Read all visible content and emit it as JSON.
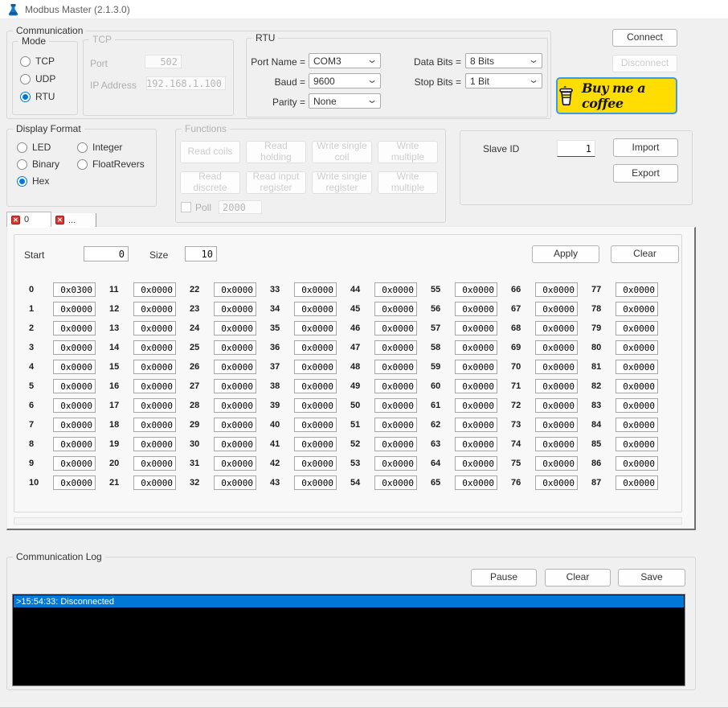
{
  "window": {
    "title": "Modbus Master (2.1.3.0)"
  },
  "colors": {
    "accent": "#0078d7",
    "coffee_bg": "#ffdd00",
    "tab_close": "#d83a33"
  },
  "communication": {
    "legend": "Communication",
    "mode": {
      "legend": "Mode",
      "options": [
        {
          "label": "TCP",
          "selected": false
        },
        {
          "label": "UDP",
          "selected": false
        },
        {
          "label": "RTU",
          "selected": true
        }
      ]
    },
    "tcp": {
      "legend": "TCP",
      "port_label": "Port",
      "port_value": "502",
      "ip_label": "IP Address",
      "ip_value": "192.168.1.100"
    },
    "rtu": {
      "legend": "RTU",
      "port_name_label": "Port Name =",
      "port_name_value": "COM3",
      "baud_label": "Baud =",
      "baud_value": "9600",
      "parity_label": "Parity =",
      "parity_value": "None",
      "data_bits_label": "Data Bits =",
      "data_bits_value": "8 Bits",
      "stop_bits_label": "Stop Bits =",
      "stop_bits_value": "1 Bit"
    }
  },
  "actions": {
    "connect": "Connect",
    "disconnect": "Disconnect",
    "coffee": "Buy me a coffee"
  },
  "display_format": {
    "legend": "Display Format",
    "options": [
      {
        "label": "LED",
        "selected": false
      },
      {
        "label": "Integer",
        "selected": false
      },
      {
        "label": "Binary",
        "selected": false
      },
      {
        "label": "FloatRevers",
        "selected": false
      },
      {
        "label": "Hex",
        "selected": true
      }
    ]
  },
  "functions": {
    "legend": "Functions",
    "buttons": [
      "Read coils",
      "Read holding",
      "Write single coil",
      "Write multiple",
      "Read discrete",
      "Read input register",
      "Write single register",
      "Write multiple"
    ],
    "poll_label": "Poll",
    "poll_value": "2000",
    "poll_checked": false
  },
  "slave": {
    "label": "Slave ID",
    "value": "1",
    "import_label": "Import",
    "export_label": "Export"
  },
  "tabs": [
    {
      "label": "0",
      "selected": true
    },
    {
      "label": "...",
      "selected": false
    }
  ],
  "register_panel": {
    "start_label": "Start",
    "start_value": "0",
    "size_label": "Size",
    "size_value": "10",
    "apply_label": "Apply",
    "clear_label": "Clear",
    "registers": [
      {
        "i": "0",
        "v": "0x0300"
      },
      {
        "i": "1",
        "v": "0x0000"
      },
      {
        "i": "2",
        "v": "0x0000"
      },
      {
        "i": "3",
        "v": "0x0000"
      },
      {
        "i": "4",
        "v": "0x0000"
      },
      {
        "i": "5",
        "v": "0x0000"
      },
      {
        "i": "6",
        "v": "0x0000"
      },
      {
        "i": "7",
        "v": "0x0000"
      },
      {
        "i": "8",
        "v": "0x0000"
      },
      {
        "i": "9",
        "v": "0x0000"
      },
      {
        "i": "10",
        "v": "0x0000"
      },
      {
        "i": "11",
        "v": "0x0000"
      },
      {
        "i": "12",
        "v": "0x0000"
      },
      {
        "i": "13",
        "v": "0x0000"
      },
      {
        "i": "14",
        "v": "0x0000"
      },
      {
        "i": "15",
        "v": "0x0000"
      },
      {
        "i": "16",
        "v": "0x0000"
      },
      {
        "i": "17",
        "v": "0x0000"
      },
      {
        "i": "18",
        "v": "0x0000"
      },
      {
        "i": "19",
        "v": "0x0000"
      },
      {
        "i": "20",
        "v": "0x0000"
      },
      {
        "i": "21",
        "v": "0x0000"
      },
      {
        "i": "22",
        "v": "0x0000"
      },
      {
        "i": "23",
        "v": "0x0000"
      },
      {
        "i": "24",
        "v": "0x0000"
      },
      {
        "i": "25",
        "v": "0x0000"
      },
      {
        "i": "26",
        "v": "0x0000"
      },
      {
        "i": "27",
        "v": "0x0000"
      },
      {
        "i": "28",
        "v": "0x0000"
      },
      {
        "i": "29",
        "v": "0x0000"
      },
      {
        "i": "30",
        "v": "0x0000"
      },
      {
        "i": "31",
        "v": "0x0000"
      },
      {
        "i": "32",
        "v": "0x0000"
      },
      {
        "i": "33",
        "v": "0x0000"
      },
      {
        "i": "34",
        "v": "0x0000"
      },
      {
        "i": "35",
        "v": "0x0000"
      },
      {
        "i": "36",
        "v": "0x0000"
      },
      {
        "i": "37",
        "v": "0x0000"
      },
      {
        "i": "38",
        "v": "0x0000"
      },
      {
        "i": "39",
        "v": "0x0000"
      },
      {
        "i": "40",
        "v": "0x0000"
      },
      {
        "i": "41",
        "v": "0x0000"
      },
      {
        "i": "42",
        "v": "0x0000"
      },
      {
        "i": "43",
        "v": "0x0000"
      },
      {
        "i": "44",
        "v": "0x0000"
      },
      {
        "i": "45",
        "v": "0x0000"
      },
      {
        "i": "46",
        "v": "0x0000"
      },
      {
        "i": "47",
        "v": "0x0000"
      },
      {
        "i": "48",
        "v": "0x0000"
      },
      {
        "i": "49",
        "v": "0x0000"
      },
      {
        "i": "50",
        "v": "0x0000"
      },
      {
        "i": "51",
        "v": "0x0000"
      },
      {
        "i": "52",
        "v": "0x0000"
      },
      {
        "i": "53",
        "v": "0x0000"
      },
      {
        "i": "54",
        "v": "0x0000"
      },
      {
        "i": "55",
        "v": "0x0000"
      },
      {
        "i": "56",
        "v": "0x0000"
      },
      {
        "i": "57",
        "v": "0x0000"
      },
      {
        "i": "58",
        "v": "0x0000"
      },
      {
        "i": "59",
        "v": "0x0000"
      },
      {
        "i": "60",
        "v": "0x0000"
      },
      {
        "i": "61",
        "v": "0x0000"
      },
      {
        "i": "62",
        "v": "0x0000"
      },
      {
        "i": "63",
        "v": "0x0000"
      },
      {
        "i": "64",
        "v": "0x0000"
      },
      {
        "i": "65",
        "v": "0x0000"
      },
      {
        "i": "66",
        "v": "0x0000"
      },
      {
        "i": "67",
        "v": "0x0000"
      },
      {
        "i": "68",
        "v": "0x0000"
      },
      {
        "i": "69",
        "v": "0x0000"
      },
      {
        "i": "70",
        "v": "0x0000"
      },
      {
        "i": "71",
        "v": "0x0000"
      },
      {
        "i": "72",
        "v": "0x0000"
      },
      {
        "i": "73",
        "v": "0x0000"
      },
      {
        "i": "74",
        "v": "0x0000"
      },
      {
        "i": "75",
        "v": "0x0000"
      },
      {
        "i": "76",
        "v": "0x0000"
      },
      {
        "i": "77",
        "v": "0x0000"
      },
      {
        "i": "78",
        "v": "0x0000"
      },
      {
        "i": "79",
        "v": "0x0000"
      },
      {
        "i": "80",
        "v": "0x0000"
      },
      {
        "i": "81",
        "v": "0x0000"
      },
      {
        "i": "82",
        "v": "0x0000"
      },
      {
        "i": "83",
        "v": "0x0000"
      },
      {
        "i": "84",
        "v": "0x0000"
      },
      {
        "i": "85",
        "v": "0x0000"
      },
      {
        "i": "86",
        "v": "0x0000"
      },
      {
        "i": "87",
        "v": "0x0000"
      }
    ]
  },
  "log": {
    "legend": "Communication Log",
    "pause_label": "Pause",
    "clear_label": "Clear",
    "save_label": "Save",
    "entries": [
      {
        "text": ">15:54:33: Disconnected",
        "selected": true
      }
    ]
  }
}
